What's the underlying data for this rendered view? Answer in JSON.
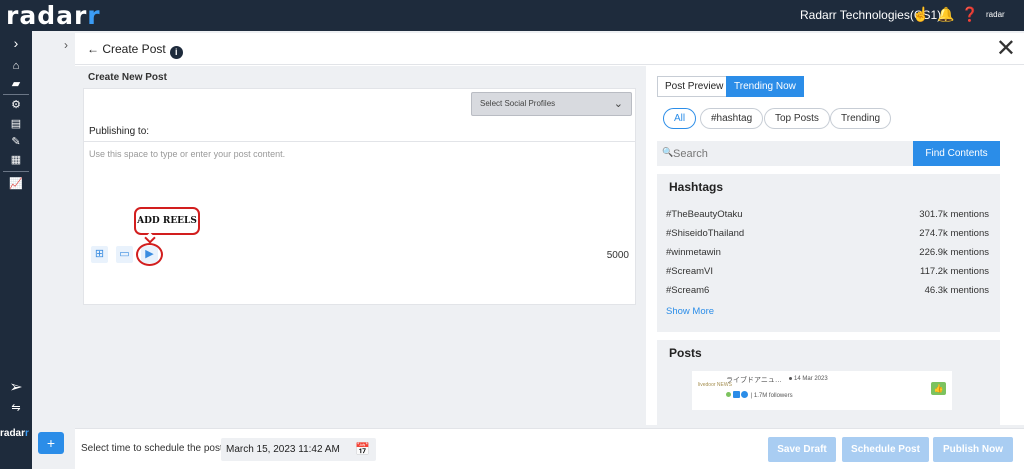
{
  "topbar": {
    "logo_text": "radar",
    "logo_arc": "r",
    "org_name": "Radarr Technologies(CS1)",
    "icons": [
      "hand-icon",
      "bell-icon",
      "help-icon"
    ],
    "mini_logo": "radar"
  },
  "sidebar": {
    "icons": [
      "chevron-right-icon",
      "home-icon",
      "tag-icon",
      "settings-icon",
      "inbox-icon",
      "compose-icon",
      "grid-icon",
      "analytics-icon",
      "send-icon",
      "sync-icon"
    ],
    "logo_text": "radar",
    "logo_arc": "r",
    "plus_label": "+"
  },
  "header": {
    "back_label": "← Create Post",
    "info_label": "i",
    "close_label": "✕"
  },
  "compose": {
    "section_title": "Create New Post",
    "select_profiles": "Select Social Profiles",
    "publishing_to": "Publishing to:",
    "placeholder": "Use this space to type or enter your post content.",
    "callout_text": "ADD REELS",
    "char_count": "5000"
  },
  "preview": {
    "tabs": [
      "Post Preview",
      "Trending Now"
    ],
    "active_tab": "Trending Now",
    "filters": [
      "All",
      "#hashtag",
      "Top Posts",
      "Trending"
    ],
    "active_filter": "All",
    "search_placeholder": "Search",
    "find_button": "Find Contents",
    "hashtags_title": "Hashtags",
    "hashtags": [
      {
        "tag": "#TheBeautyOtaku",
        "count": "301.7k mentions"
      },
      {
        "tag": "#ShiseidoThailand",
        "count": "274.7k mentions"
      },
      {
        "tag": "#winmetawin",
        "count": "226.9k mentions"
      },
      {
        "tag": "#ScreamVI",
        "count": "117.2k mentions"
      },
      {
        "tag": "#Scream6",
        "count": "46.3k mentions"
      }
    ],
    "show_more": "Show More",
    "posts_title": "Posts",
    "post": {
      "logo_text": "livedoor NEWS",
      "name": "ライブドアニュ…",
      "date": "14 Mar 2023",
      "followers": "| 1.7M followers"
    }
  },
  "footer": {
    "schedule_label": "Select time to schedule the post :",
    "schedule_value": "March 15, 2023 11:42 AM",
    "save_draft": "Save Draft",
    "schedule_post": "Schedule Post",
    "publish_now": "Publish Now"
  },
  "colors": {
    "nav_bg": "#1e2b3c",
    "accent": "#2b8de8",
    "disabled_button": "#a9cdf2",
    "callout": "#d21e1e"
  }
}
